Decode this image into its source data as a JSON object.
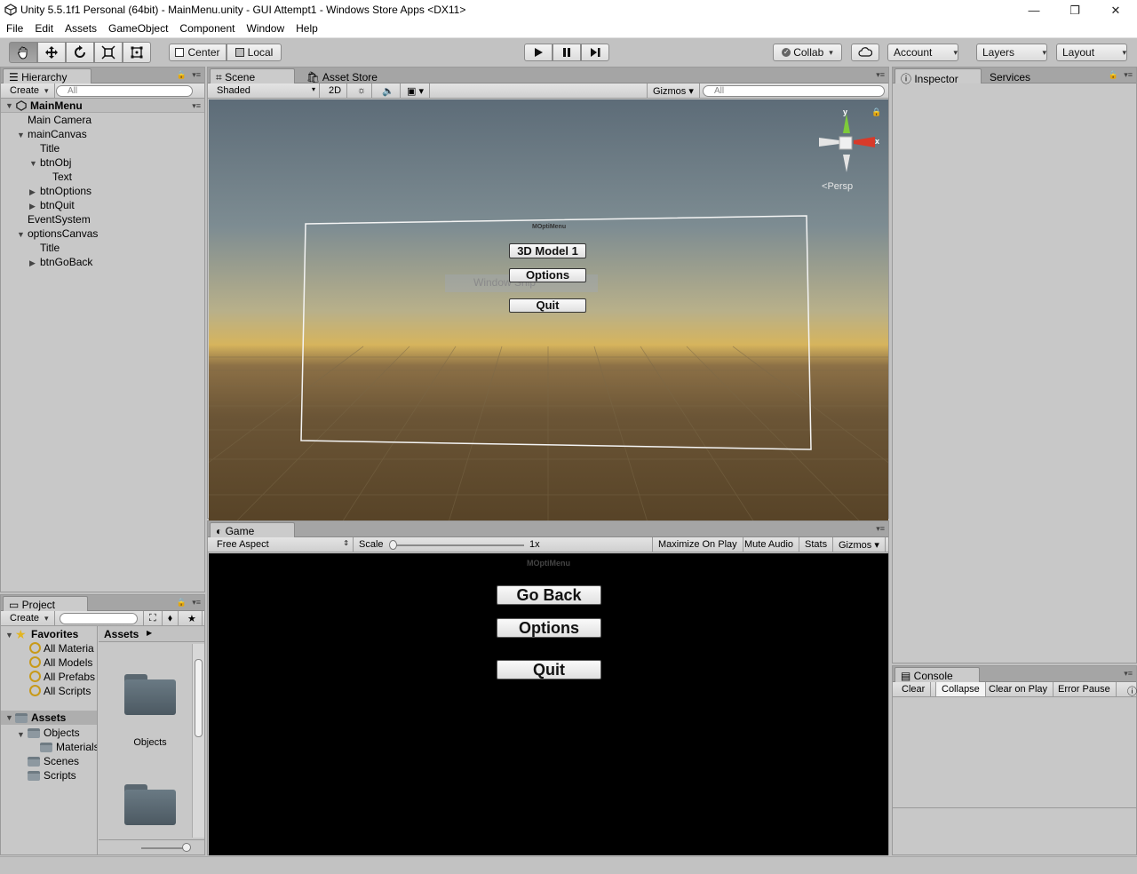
{
  "window": {
    "title": "Unity 5.5.1f1 Personal (64bit) - MainMenu.unity - GUI Attempt1 - Windows Store Apps <DX11>",
    "minimize": "—",
    "maximize": "❐",
    "close": "✕"
  },
  "menu": [
    "File",
    "Edit",
    "Assets",
    "GameObject",
    "Component",
    "Window",
    "Help"
  ],
  "toolbar": {
    "pivot_center": "Center",
    "pivot_local": "Local",
    "collab": "Collab",
    "account": "Account",
    "layers": "Layers",
    "layout": "Layout"
  },
  "hierarchy": {
    "tab": "Hierarchy",
    "create": "Create",
    "search_placeholder": "All",
    "scene": "MainMenu",
    "items": [
      {
        "label": "Main Camera"
      },
      {
        "label": "mainCanvas"
      },
      {
        "label": "Title"
      },
      {
        "label": "btnObj"
      },
      {
        "label": "Text"
      },
      {
        "label": "btnOptions"
      },
      {
        "label": "btnQuit"
      },
      {
        "label": "EventSystem"
      },
      {
        "label": "optionsCanvas"
      },
      {
        "label": "Title"
      },
      {
        "label": "btnGoBack"
      }
    ]
  },
  "scene": {
    "tab": "Scene",
    "asset_store_tab": "Asset Store",
    "shading": "Shaded",
    "mode_2d": "2D",
    "gizmos": "Gizmos",
    "search_placeholder": "All",
    "persp": "Persp",
    "axis_y": "y",
    "axis_x": "x",
    "canvas_title": "MOptiMenu",
    "buttons": {
      "model": "3D Model 1",
      "options": "Options",
      "quit": "Quit"
    },
    "ghost_text": "Window Ship"
  },
  "game": {
    "tab": "Game",
    "aspect": "Free Aspect",
    "scale_label": "Scale",
    "scale_value": "1x",
    "maximize": "Maximize On Play",
    "mute": "Mute Audio",
    "stats": "Stats",
    "gizmos": "Gizmos",
    "canvas_title": "MOptiMenu",
    "buttons": {
      "go_back": "Go Back",
      "options": "Options",
      "quit": "Quit"
    }
  },
  "inspector": {
    "tab": "Inspector",
    "services_tab": "Services"
  },
  "console": {
    "tab": "Console",
    "clear": "Clear",
    "collapse": "Collapse",
    "clear_on_play": "Clear on Play",
    "error_pause": "Error Pause"
  },
  "project": {
    "tab": "Project",
    "create": "Create",
    "favorites": "Favorites",
    "fav_items": [
      "All Materia",
      "All Models",
      "All Prefabs",
      "All Scripts"
    ],
    "assets_root": "Assets",
    "asset_tree": [
      "Objects",
      "Materials",
      "Scenes",
      "Scripts"
    ],
    "breadcrumb": "Assets",
    "grid_items": [
      {
        "label": "Objects"
      },
      {
        "label": ""
      }
    ]
  },
  "colors": {
    "accent_play": "#1a1a1a",
    "selection": "#3e7de0"
  }
}
